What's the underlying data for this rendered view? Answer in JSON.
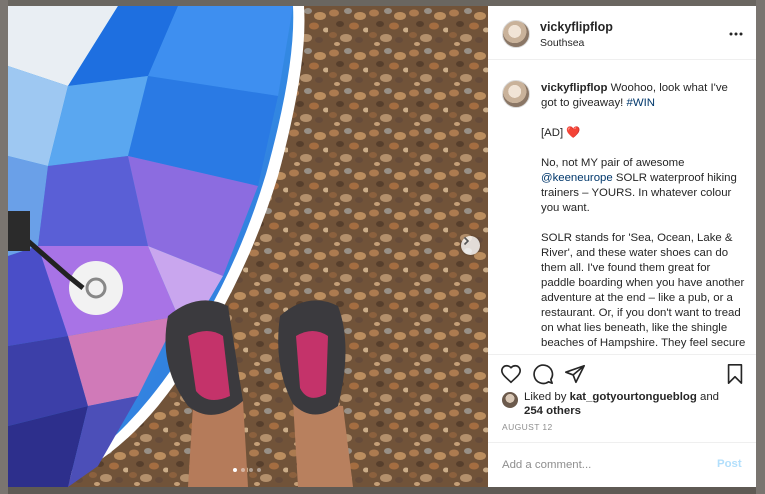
{
  "post": {
    "username": "vickyflipflop",
    "location": "Southsea",
    "caption": {
      "username": "vickyflipflop",
      "intro": "Woohoo, look what I've got to giveaway!",
      "hashtag": "#WIN",
      "ad": "[AD]",
      "heart": "❤️",
      "p2_before": "No, not MY pair of awesome",
      "mention": "@keeneurope",
      "p2_after": "SOLR waterproof hiking trainers – YOURS. In whatever colour you want.",
      "p3": "SOLR stands for 'Sea, Ocean, Lake & River', and these water shoes can do them all. I've found them great for paddle boarding when you have another adventure at the end – like a pub, or a restaurant. Or, if you don't want to tread on what lies beneath, like the shingle beaches of Hampshire. They feel secure on your"
    },
    "likes": {
      "prefix": "Liked by",
      "liker": "kat_gotyourtongueblog",
      "conjunction": "and",
      "others": "254 others"
    },
    "date": "AUGUST 12",
    "comment": {
      "placeholder": "Add a comment...",
      "post_label": "Post"
    },
    "carousel": {
      "total": 4,
      "active_index": 0
    }
  },
  "icons": {
    "more": "more-options-icon",
    "like": "heart-icon",
    "comment": "comment-icon",
    "share": "share-icon",
    "save": "bookmark-icon",
    "next": "chevron-right-icon"
  },
  "colors": {
    "link": "#00376b",
    "post_button_disabled": "#b2dffc",
    "secondary_text": "#8e8e8e",
    "heart": "#e0245e"
  }
}
